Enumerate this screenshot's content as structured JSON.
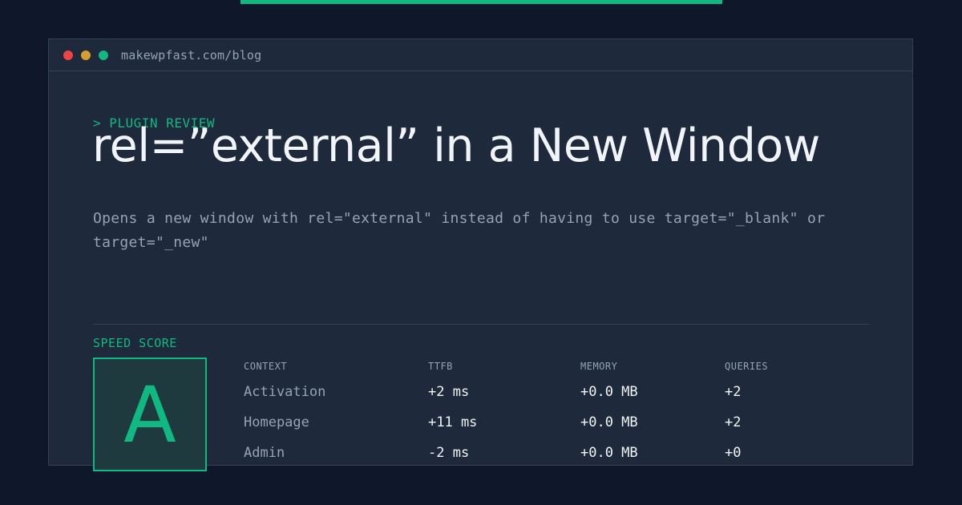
{
  "colors": {
    "background": "#0f172a",
    "window": "#1e293b",
    "accent": "#10b981",
    "muted_text": "#94a3b8",
    "bright_text": "#f1f5f9"
  },
  "window": {
    "url": "makewpfast.com/blog"
  },
  "article": {
    "eyebrow": "> PLUGIN REVIEW",
    "title": "rel=”external” in a New Window",
    "description": "Opens a new window with rel=\"external\" instead of having to use target=\"_blank\" or target=\"_new\""
  },
  "speed": {
    "label": "SPEED SCORE",
    "grade": "A"
  },
  "metrics": {
    "columns": [
      "CONTEXT",
      "TTFB",
      "MEMORY",
      "QUERIES"
    ],
    "rows": [
      [
        "Activation",
        "+2 ms",
        "+0.0 MB",
        "+2"
      ],
      [
        "Homepage",
        "+11 ms",
        "+0.0 MB",
        "+2"
      ],
      [
        "Admin",
        "-2 ms",
        "+0.0 MB",
        "+0"
      ]
    ]
  }
}
